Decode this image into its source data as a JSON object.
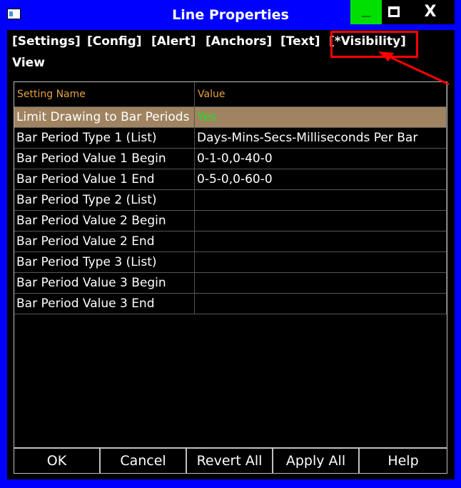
{
  "window": {
    "title": "Line Properties",
    "icons": {
      "app": "app-window-icon",
      "minimize": "minimize-icon",
      "maximize": "maximize-icon",
      "close": "close-icon"
    },
    "close_glyph": "X"
  },
  "tabs": [
    "[Settings]",
    "[Config]",
    "[Alert]",
    "[Anchors]",
    "[Text]",
    "[*Visibility]"
  ],
  "view_label": "View",
  "grid": {
    "columns": [
      "Setting Name",
      "Value"
    ],
    "rows": [
      {
        "name": "Limit Drawing to Bar Periods",
        "value": "Yes"
      },
      {
        "name": "Bar Period Type 1 (List)",
        "value": "Days-Mins-Secs-Milliseconds Per Bar"
      },
      {
        "name": "Bar Period Value 1 Begin",
        "value": "0-1-0,0-40-0"
      },
      {
        "name": "Bar Period Value 1 End",
        "value": "0-5-0,0-60-0"
      },
      {
        "name": "Bar Period Type 2 (List)",
        "value": ""
      },
      {
        "name": "Bar Period Value 2 Begin",
        "value": ""
      },
      {
        "name": "Bar Period Value 2 End",
        "value": ""
      },
      {
        "name": "Bar Period Type 3 (List)",
        "value": ""
      },
      {
        "name": "Bar Period Value 3 Begin",
        "value": ""
      },
      {
        "name": "Bar Period Value 3 End",
        "value": ""
      }
    ]
  },
  "buttons": [
    "OK",
    "Cancel",
    "Revert All",
    "Apply All",
    "Help"
  ],
  "colors": {
    "frame": "#0000ff",
    "header_text": "#e8a040",
    "selected_row": "#a08360",
    "yes_value": "#22dd22",
    "annotation": "#ff0000",
    "minimize_button": "#00e000"
  }
}
